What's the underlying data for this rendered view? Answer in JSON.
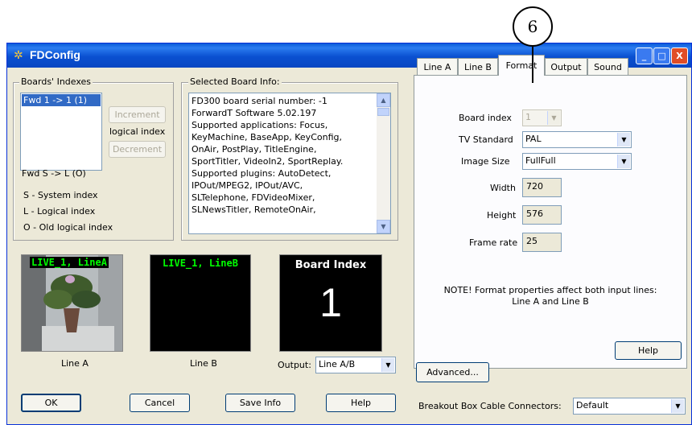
{
  "callout": {
    "number": "6"
  },
  "window": {
    "title": "FDConfig",
    "minimize": "_",
    "maximize": "□",
    "close": "X"
  },
  "boards": {
    "legend": "Boards' Indexes",
    "list_items": [
      "Fwd 1 -> 1 (1)"
    ],
    "increment_label": "Increment",
    "logical_index_label": "logical index",
    "decrement_label": "Decrement",
    "fwd_summary": "Fwd S -> L (O)",
    "key_system": "S - System index",
    "key_logical": "L - Logical index",
    "key_old": "O - Old logical index"
  },
  "board_info": {
    "legend": "Selected Board Info:",
    "lines": [
      "FD300 board serial number: -1",
      "ForwardT Software 5.02.197",
      "Supported applications: Focus,",
      "KeyMachine, BaseApp, KeyConfig,",
      "OnAir, PostPlay, TitleEngine,",
      "SportTitler, VideoIn2, SportReplay.",
      "Supported plugins: AutoDetect,",
      "IPOut/MPEG2, IPOut/AVC,",
      "SLTelephone, FDVideoMixer,",
      "SLNewsTitler, RemoteOnAir,"
    ]
  },
  "previews": {
    "line_a_title": "LIVE_1, LineA",
    "line_b_title": "LIVE_1, LineB",
    "board_index_title": "Board Index",
    "board_index_value": "1",
    "line_a_caption": "Line A",
    "line_b_caption": "Line B",
    "output_label": "Output:",
    "output_value": "Line A/B"
  },
  "buttons": {
    "ok": "OK",
    "cancel": "Cancel",
    "save_info": "Save Info",
    "help": "Help"
  },
  "tabs": [
    {
      "label": "Line A",
      "active": false
    },
    {
      "label": "Line B",
      "active": false
    },
    {
      "label": "Format",
      "active": true
    },
    {
      "label": "Output",
      "active": false
    },
    {
      "label": "Sound",
      "active": false
    }
  ],
  "format": {
    "board_index_label": "Board index",
    "board_index_value": "1",
    "tv_standard_label": "TV Standard",
    "tv_standard_value": "PAL",
    "image_size_label": "Image Size",
    "image_size_value": "FullFull",
    "width_label": "Width",
    "width_value": "720",
    "height_label": "Height",
    "height_value": "576",
    "frame_rate_label": "Frame rate",
    "frame_rate_value": "25",
    "note_line1": "NOTE! Format properties affect both input lines:",
    "note_line2": "Line A and Line B",
    "help_label": "Help"
  },
  "advanced_label": "Advanced...",
  "breakout": {
    "label": "Breakout Box Cable Connectors:",
    "value": "Default"
  }
}
